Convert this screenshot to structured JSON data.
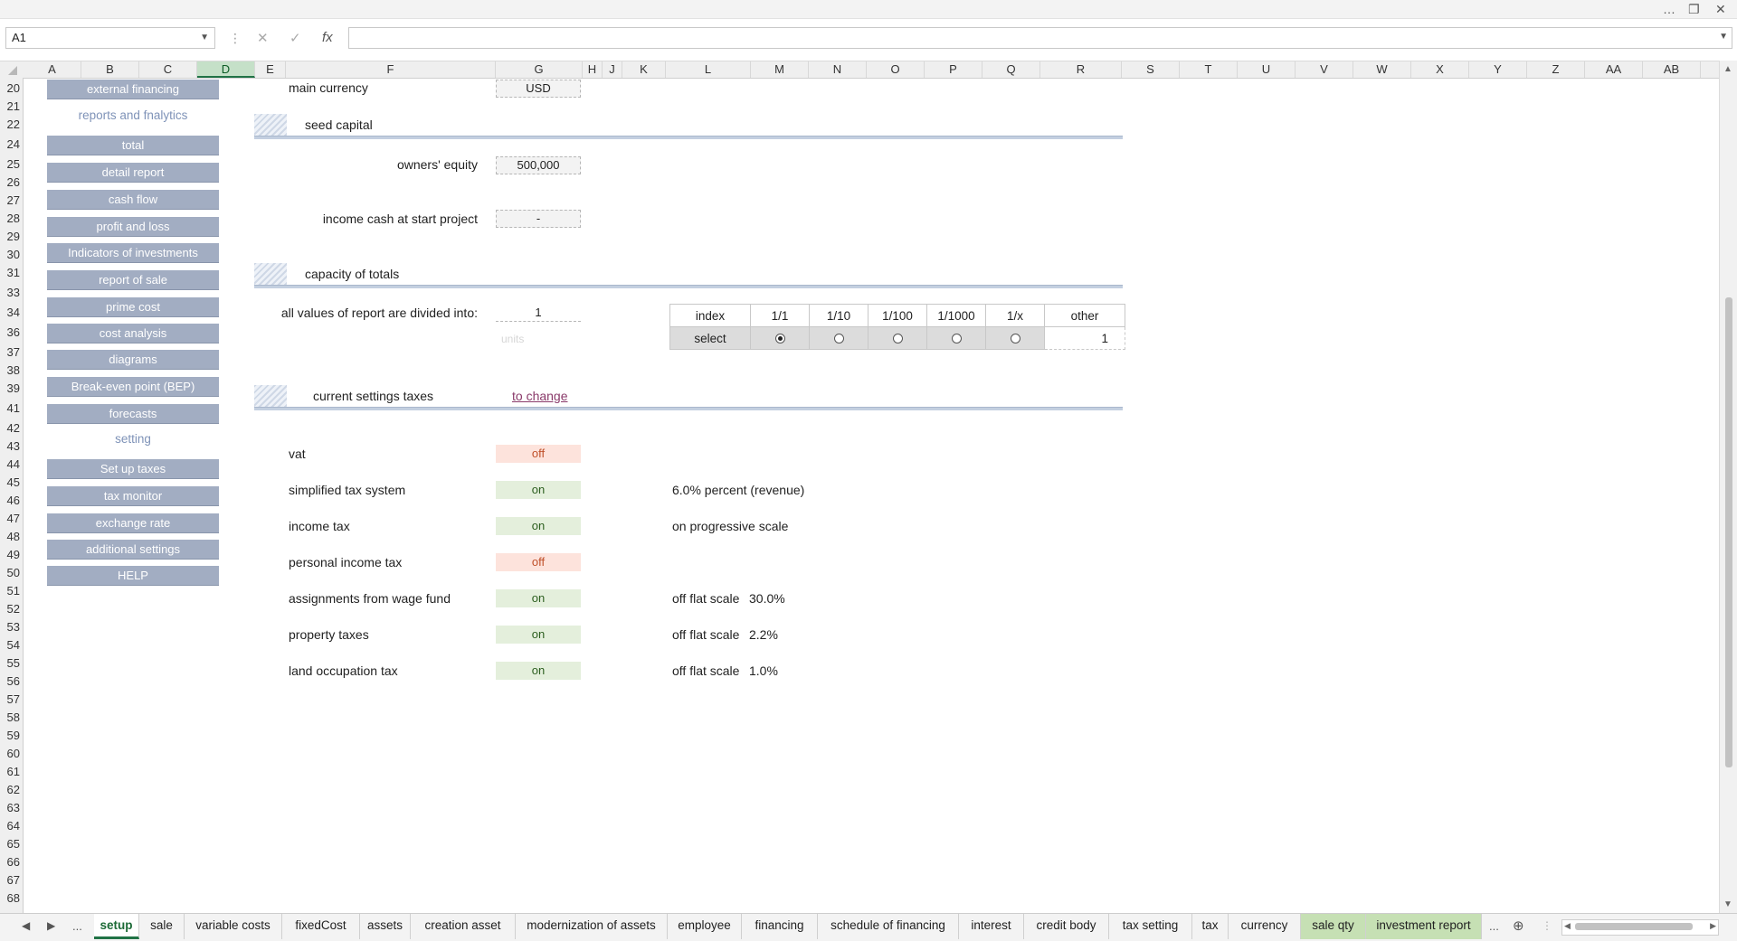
{
  "window": {
    "more_icon": "…",
    "restore_icon": "❐",
    "close_icon": "✕"
  },
  "formula_bar": {
    "cell_ref": "A1",
    "cancel_icon": "✕",
    "enter_icon": "✓",
    "fx_icon": "fx",
    "formula": ""
  },
  "columns": [
    "A",
    "B",
    "C",
    "D",
    "E",
    "F",
    "G",
    "H",
    "J",
    "K",
    "L",
    "M",
    "N",
    "O",
    "P",
    "Q",
    "R",
    "S",
    "T",
    "U",
    "V",
    "W",
    "X",
    "Y",
    "Z",
    "AA",
    "AB"
  ],
  "rows": [
    "20",
    "21",
    "22",
    "24",
    "25",
    "26",
    "27",
    "28",
    "29",
    "30",
    "31",
    "33",
    "34",
    "36",
    "37",
    "38",
    "39",
    "41",
    "42",
    "43",
    "44",
    "45",
    "46",
    "47",
    "48",
    "49",
    "50",
    "51",
    "52",
    "53",
    "54",
    "55",
    "56",
    "57",
    "58",
    "59",
    "60",
    "61",
    "62",
    "63",
    "64",
    "65",
    "66",
    "67",
    "68"
  ],
  "nav": {
    "buttons": {
      "external_financing": "external financing",
      "total": "total",
      "detail_report": "detail report",
      "cash_flow": "cash flow",
      "profit_and_loss": "profit and loss",
      "indicators_of_investments": "Indicators of investments",
      "report_of_sale": "report of sale",
      "prime_cost": "prime cost",
      "cost_analysis": "cost analysis",
      "diagrams": "diagrams",
      "break_even": "Break-even point (BEP)",
      "forecasts": "forecasts",
      "set_up_taxes": "Set up taxes",
      "tax_monitor": "tax monitor",
      "exchange_rate": "exchange rate",
      "additional_settings": "additional settings",
      "help": "HELP"
    },
    "sections": {
      "reports": "reports and fnalytics",
      "setting": "setting"
    }
  },
  "currency": {
    "label": "main currency",
    "value": "USD"
  },
  "seed_capital": {
    "title": "seed capital",
    "owners_equity_label": "owners' equity",
    "owners_equity_value": "500,000",
    "income_cash_label": "income cash at start project",
    "income_cash_value": "-"
  },
  "capacity": {
    "title": "capacity of totals",
    "divided_label": "all values of report are divided into:",
    "divided_value": "1",
    "faded_text": "units",
    "table": {
      "header": [
        "index",
        "1/1",
        "1/10",
        "1/100",
        "1/1000",
        "1/x",
        "other"
      ],
      "select_label": "select",
      "selected_index": 0,
      "other_value": "1"
    }
  },
  "taxes": {
    "title": "current settings taxes",
    "change_link": "to change",
    "items": [
      {
        "label": "vat",
        "status": "off",
        "note": "",
        "rate": ""
      },
      {
        "label": "simplified tax system",
        "status": "on",
        "note": "6.0% percent (revenue)",
        "rate": ""
      },
      {
        "label": "income tax",
        "status": "on",
        "note": "on progressive scale",
        "rate": ""
      },
      {
        "label": "personal income tax",
        "status": "off",
        "note": "",
        "rate": ""
      },
      {
        "label": "assignments from wage fund",
        "status": "on",
        "note": "off flat scale",
        "rate": "30.0%"
      },
      {
        "label": "property taxes",
        "status": "on",
        "note": "off flat scale",
        "rate": "2.2%"
      },
      {
        "label": "land occupation tax",
        "status": "on",
        "note": "off flat scale",
        "rate": "1.0%"
      }
    ]
  },
  "sheet_tabs": {
    "nav_prev": "◀",
    "nav_next": "▶",
    "ellipsis": "...",
    "add": "⊕",
    "tabs": [
      {
        "label": "setup",
        "state": "active"
      },
      {
        "label": "sale",
        "state": ""
      },
      {
        "label": "variable costs",
        "state": ""
      },
      {
        "label": "fixedCost",
        "state": ""
      },
      {
        "label": "assets",
        "state": ""
      },
      {
        "label": "creation asset",
        "state": ""
      },
      {
        "label": "modernization of assets",
        "state": ""
      },
      {
        "label": "employee",
        "state": ""
      },
      {
        "label": "financing",
        "state": ""
      },
      {
        "label": "schedule of financing",
        "state": ""
      },
      {
        "label": "interest",
        "state": ""
      },
      {
        "label": "credit body",
        "state": ""
      },
      {
        "label": "tax setting",
        "state": ""
      },
      {
        "label": "tax",
        "state": ""
      },
      {
        "label": "currency",
        "state": ""
      },
      {
        "label": "sale qty",
        "state": "green"
      },
      {
        "label": "investment report",
        "state": "green"
      }
    ]
  },
  "colors": {
    "nav_button": "#a2adc2",
    "status_on_bg": "#e4efdc",
    "status_off_bg": "#fde3dc",
    "accent": "#217346",
    "link": "#8a3a6a"
  }
}
